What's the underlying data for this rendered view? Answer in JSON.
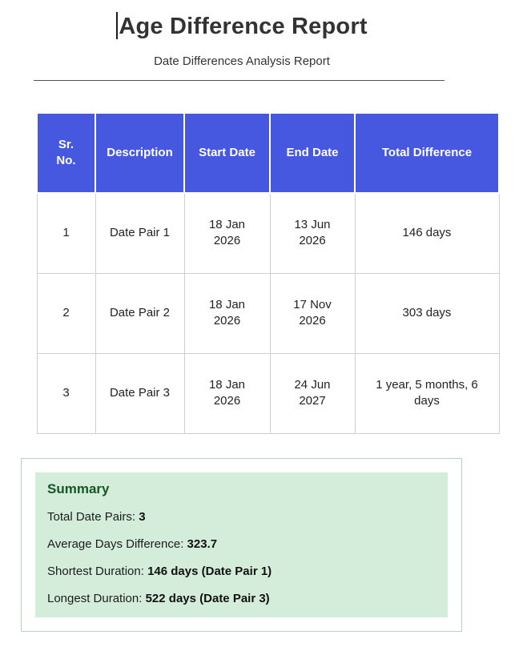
{
  "page": {
    "title": "Age Difference Report",
    "subtitle": "Date Differences Analysis Report"
  },
  "table": {
    "columns": [
      "Sr. No.",
      "Description",
      "Start Date",
      "End Date",
      "Total Difference"
    ],
    "rows": [
      {
        "sr": "1",
        "description": "Date Pair 1",
        "start": "18 Jan 2026",
        "end": "13 Jun 2026",
        "total": "146 days"
      },
      {
        "sr": "2",
        "description": "Date Pair 2",
        "start": "18 Jan 2026",
        "end": "17 Nov 2026",
        "total": "303 days"
      },
      {
        "sr": "3",
        "description": "Date Pair 3",
        "start": "18 Jan 2026",
        "end": "24 Jun 2027",
        "total": "1 year, 5 months, 6 days"
      }
    ]
  },
  "summary": {
    "heading": "Summary",
    "items": [
      {
        "label": "Total Date Pairs:",
        "value": "3"
      },
      {
        "label": "Average Days Difference:",
        "value": "323.7"
      },
      {
        "label": "Shortest Duration:",
        "value": "146 days (Date Pair 1)"
      },
      {
        "label": "Longest Duration:",
        "value": "522 days (Date Pair 3)"
      }
    ]
  },
  "colors": {
    "header_bg": "#4657e0",
    "header_text": "#ffffff",
    "cell_border": "#cfcfcf",
    "summary_bg": "#d4edda",
    "summary_heading": "#155724",
    "summary_box_border": "#bccfc2",
    "title_text": "#333333"
  }
}
